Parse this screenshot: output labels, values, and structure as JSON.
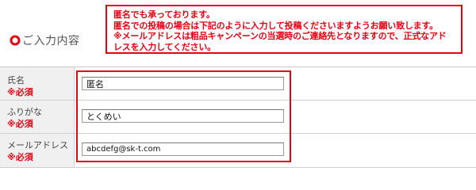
{
  "notice": {
    "lines": [
      "匿名でも承っております。",
      "匿名での投稿の場合は下記のように入力して投稿くださいますようお願い致します。",
      "※メールアドレスは粗品キャンペーンの当選時のご連絡先となりますので、正式なアド",
      "レスを入力してください。"
    ]
  },
  "section": {
    "title": "ご入力内容"
  },
  "form": {
    "rows": [
      {
        "label": "氏名",
        "required": "※必須",
        "value": "匿名"
      },
      {
        "label": "ふりがな",
        "required": "※必須",
        "value": "とくめい"
      },
      {
        "label": "メールアドレス",
        "required": "※必須",
        "value": "abcdefg@sk-t.com"
      }
    ]
  },
  "colors": {
    "accent_red": "#e60012",
    "label_bg": "#f0f0f0",
    "border_gray": "#d0d0d0"
  }
}
